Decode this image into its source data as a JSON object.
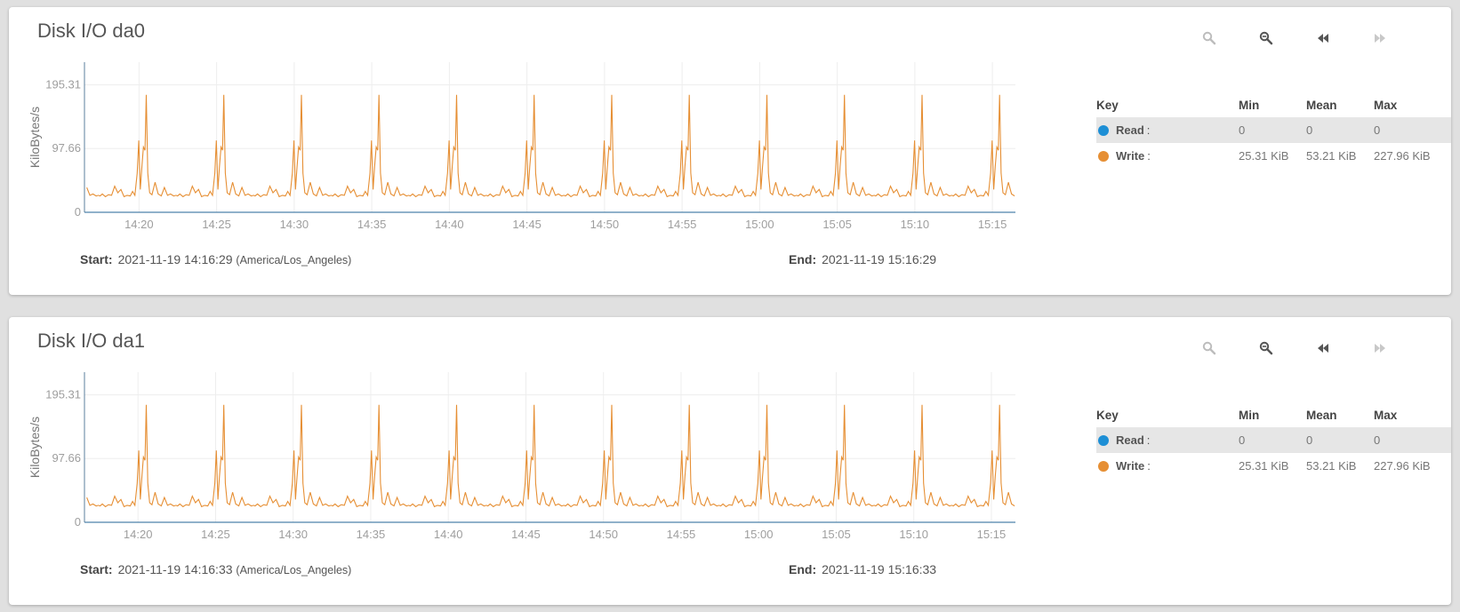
{
  "colors": {
    "read": "#1e8fd5",
    "write": "#e68f34",
    "grid": "#eeeeee",
    "axis": "#5b7f9e"
  },
  "toolbar_icons": [
    "zoom-in-icon",
    "zoom-out-icon",
    "step-back-icon",
    "step-forward-icon"
  ],
  "legend_headers": {
    "key": "Key",
    "min": "Min",
    "mean": "Mean",
    "max": "Max"
  },
  "cards": [
    {
      "title": "Disk I/O da0",
      "start_label": "Start:",
      "start_value": "2021-11-19 14:16:29",
      "start_tz": "(America/Los_Angeles)",
      "end_label": "End:",
      "end_value": "2021-11-19 15:16:29",
      "legend": [
        {
          "name": "Read",
          "colon": ":",
          "min": "0",
          "mean": "0",
          "max": "0"
        },
        {
          "name": "Write",
          "colon": ":",
          "min": "25.31 KiB",
          "mean": "53.21 KiB",
          "max": "227.96 KiB"
        }
      ]
    },
    {
      "title": "Disk I/O da1",
      "start_label": "Start:",
      "start_value": "2021-11-19 14:16:33",
      "start_tz": "(America/Los_Angeles)",
      "end_label": "End:",
      "end_value": "2021-11-19 15:16:33",
      "legend": [
        {
          "name": "Read",
          "colon": ":",
          "min": "0",
          "mean": "0",
          "max": "0"
        },
        {
          "name": "Write",
          "colon": ":",
          "min": "25.31 KiB",
          "mean": "53.21 KiB",
          "max": "227.96 KiB"
        }
      ]
    }
  ],
  "chart_data": [
    {
      "type": "line",
      "ylabel": "KiloBytes/s",
      "yticks": [
        0,
        97.66,
        195.31
      ],
      "ytick_labels": [
        "0",
        "97.66",
        "195.31"
      ],
      "ylim": [
        0,
        230
      ],
      "xlim": [
        "14:16:29",
        "15:16:29"
      ],
      "xticks": [
        "14:20",
        "14:25",
        "14:30",
        "14:35",
        "14:40",
        "14:45",
        "14:50",
        "14:55",
        "15:00",
        "15:05",
        "15:10",
        "15:15"
      ],
      "grid": true,
      "series": [
        {
          "name": "Read",
          "flat_value": 0
        },
        {
          "name": "Write",
          "period_minutes": 5,
          "pattern": [
            [
              0.0,
              25
            ],
            [
              0.15,
              28
            ],
            [
              0.35,
              24
            ],
            [
              0.55,
              27
            ],
            [
              0.75,
              26
            ],
            [
              0.95,
              40
            ],
            [
              1.15,
              30
            ],
            [
              1.35,
              35
            ],
            [
              1.55,
              24
            ],
            [
              1.75,
              26
            ],
            [
              1.95,
              25
            ],
            [
              2.1,
              32
            ],
            [
              2.25,
              26
            ],
            [
              2.4,
              60
            ],
            [
              2.5,
              110
            ],
            [
              2.6,
              35
            ],
            [
              2.7,
              70
            ],
            [
              2.8,
              100
            ],
            [
              2.9,
              95
            ],
            [
              2.98,
              180
            ],
            [
              3.08,
              60
            ],
            [
              3.2,
              30
            ],
            [
              3.35,
              27
            ],
            [
              3.55,
              46
            ],
            [
              3.75,
              28
            ],
            [
              3.95,
              25
            ],
            [
              4.15,
              38
            ],
            [
              4.35,
              26
            ],
            [
              4.55,
              28
            ],
            [
              4.75,
              25
            ],
            [
              4.9,
              26
            ]
          ],
          "stats": {
            "min": 25.31,
            "mean": 53.21,
            "max": 227.96
          }
        }
      ]
    },
    {
      "type": "line",
      "ylabel": "KiloBytes/s",
      "yticks": [
        0,
        97.66,
        195.31
      ],
      "ytick_labels": [
        "0",
        "97.66",
        "195.31"
      ],
      "ylim": [
        0,
        230
      ],
      "xlim": [
        "14:16:33",
        "15:16:33"
      ],
      "xticks": [
        "14:20",
        "14:25",
        "14:30",
        "14:35",
        "14:40",
        "14:45",
        "14:50",
        "14:55",
        "15:00",
        "15:05",
        "15:10",
        "15:15"
      ],
      "grid": true,
      "series": [
        {
          "name": "Read",
          "flat_value": 0
        },
        {
          "name": "Write",
          "period_minutes": 5,
          "pattern": [
            [
              0.0,
              25
            ],
            [
              0.15,
              28
            ],
            [
              0.35,
              24
            ],
            [
              0.55,
              27
            ],
            [
              0.75,
              26
            ],
            [
              0.95,
              40
            ],
            [
              1.15,
              30
            ],
            [
              1.35,
              35
            ],
            [
              1.55,
              24
            ],
            [
              1.75,
              26
            ],
            [
              1.95,
              25
            ],
            [
              2.1,
              32
            ],
            [
              2.25,
              26
            ],
            [
              2.4,
              60
            ],
            [
              2.5,
              110
            ],
            [
              2.6,
              35
            ],
            [
              2.7,
              70
            ],
            [
              2.8,
              100
            ],
            [
              2.9,
              95
            ],
            [
              2.98,
              180
            ],
            [
              3.08,
              60
            ],
            [
              3.2,
              30
            ],
            [
              3.35,
              27
            ],
            [
              3.55,
              46
            ],
            [
              3.75,
              28
            ],
            [
              3.95,
              25
            ],
            [
              4.15,
              38
            ],
            [
              4.35,
              26
            ],
            [
              4.55,
              28
            ],
            [
              4.75,
              25
            ],
            [
              4.9,
              26
            ]
          ],
          "stats": {
            "min": 25.31,
            "mean": 53.21,
            "max": 227.96
          }
        }
      ]
    }
  ]
}
